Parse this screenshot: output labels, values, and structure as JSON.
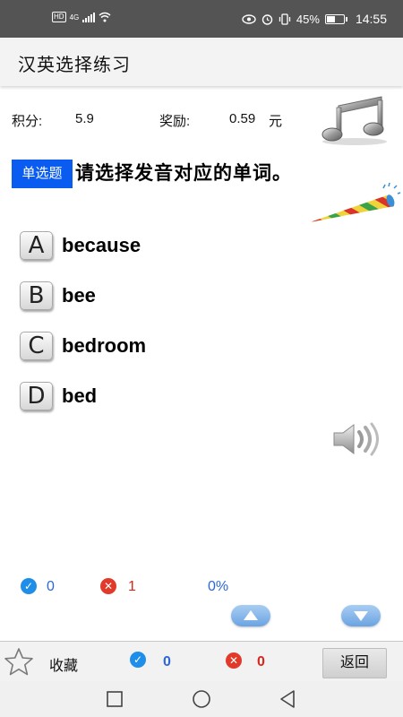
{
  "status_bar": {
    "battery": "45%",
    "battery_level": 0.45,
    "time": "14:55",
    "network": "4G",
    "hd_label": "HD"
  },
  "app": {
    "title": "汉英选择练习"
  },
  "score": {
    "points_label": "积分:",
    "points_value": "5.9",
    "reward_label": "奖励:",
    "reward_value": "0.59",
    "reward_unit": "元"
  },
  "question": {
    "type_badge": "单选题",
    "prompt": "请选择发音对应的单词。"
  },
  "options": [
    {
      "key": "A",
      "text": "because"
    },
    {
      "key": "B",
      "text": "bee"
    },
    {
      "key": "C",
      "text": "bedroom"
    },
    {
      "key": "D",
      "text": "bed"
    }
  ],
  "stats": {
    "correct_count": "0",
    "wrong_count": "1",
    "accuracy": "0%"
  },
  "bottom_bar": {
    "favorite_label": "收藏",
    "correct_count": "0",
    "wrong_count": "0",
    "return_label": "返回"
  },
  "colors": {
    "accent_blue": "#0a5cf0",
    "correct_blue": "#1f8ee8",
    "wrong_red": "#e23a2a",
    "stat_blue_text": "#2b67d8",
    "stat_red_text": "#d8261c"
  },
  "icons": {
    "music": "music-note-icon",
    "horn": "party-horn-icon",
    "speaker": "speaker-icon",
    "up": "arrow-up-icon",
    "down": "arrow-down-icon",
    "star": "star-icon",
    "check": "check-circle-icon",
    "cross": "cross-circle-icon"
  }
}
